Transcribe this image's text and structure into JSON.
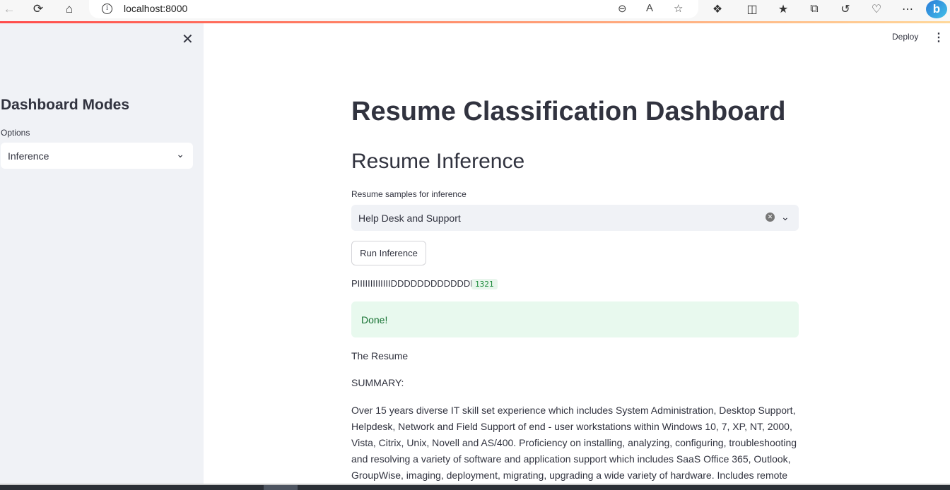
{
  "browser": {
    "url": "localhost:8000",
    "bing_label": "b"
  },
  "header": {
    "deploy_label": "Deploy"
  },
  "sidebar": {
    "title": "Dashboard Modes",
    "options_label": "Options",
    "selected_option": "Inference"
  },
  "main": {
    "title": "Resume Classification Dashboard",
    "section_title": "Resume Inference",
    "samples_label": "Resume samples for inference",
    "selected_sample": "Help Desk and Support",
    "run_button": "Run Inference",
    "prediction_text": "PIIIIIIIIIIIIIDDDDDDDDDDDDD",
    "prediction_badge": "1321",
    "status_message": "Done!",
    "resume_heading": "The Resume",
    "summary_heading": "SUMMARY:",
    "summary_text": "Over 15 years diverse IT skill set experience which includes System Administration, Desktop Support, Helpdesk, Network and Field Support of end - user workstations within Windows 10, 7, XP, NT, 2000, Vista, Citrix, Unix, Novell and AS/400. Proficiency on installing, analyzing, configuring, troubleshooting and resolving a variety of software and application support which includes SaaS Office 365, Outlook, GroupWise, imaging, deployment, migrating, upgrading a wide variety of hardware. Includes remote"
  },
  "icons": {
    "back": "back-arrow-icon",
    "reload": "reload-icon",
    "home": "home-icon",
    "info": "info-icon",
    "zoom": "zoom-out-icon",
    "read_aloud": "read-aloud-icon",
    "favorite": "star-icon",
    "extensions": "puzzle-icon",
    "split": "split-screen-icon",
    "favorites": "favorites-icon",
    "collections": "collections-icon",
    "history": "history-icon",
    "performance": "heart-pulse-icon",
    "more": "more-icon",
    "close": "close-icon",
    "chevron": "chevron-down-icon",
    "clear": "clear-icon",
    "kebab": "kebab-menu-icon"
  },
  "colors": {
    "accent_red": "#ff4b4b",
    "sidebar_bg": "#f0f2f6",
    "success_bg": "#e8f9ee",
    "success_text": "#177233"
  }
}
